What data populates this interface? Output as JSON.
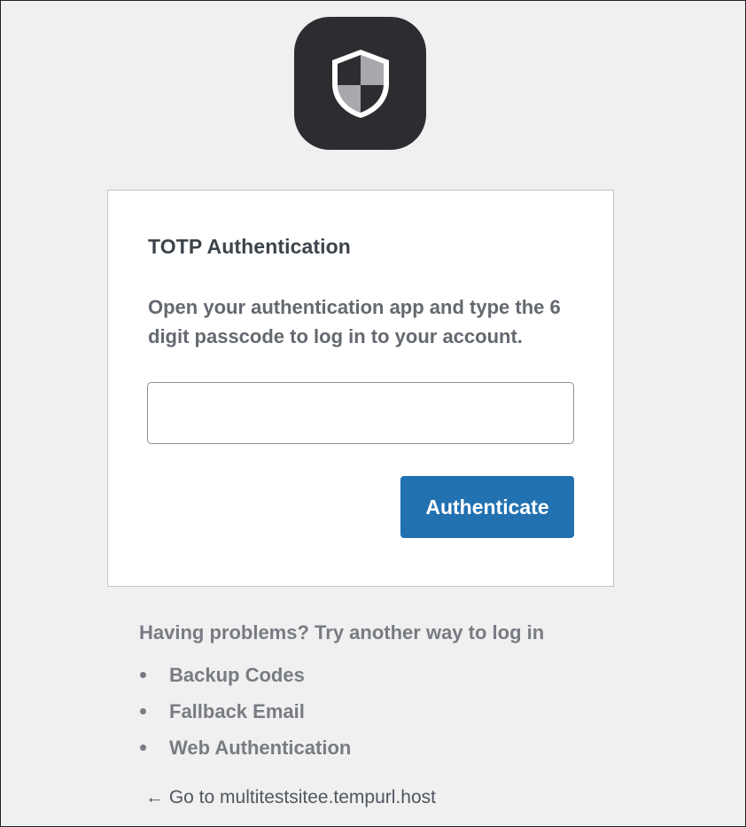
{
  "logo": {
    "icon": "shield-icon",
    "bg_color": "#2c2d30"
  },
  "card": {
    "title": "TOTP Authentication",
    "description": "Open your authentication app and type the 6 digit passcode to log in to your account.",
    "input": {
      "value": "",
      "placeholder": ""
    },
    "button_label": "Authenticate",
    "button_color": "#2271b1"
  },
  "alternatives": {
    "heading": "Having problems? Try another way to log in",
    "options": [
      {
        "label": "Backup Codes"
      },
      {
        "label": "Fallback Email"
      },
      {
        "label": "Web Authentication"
      }
    ]
  },
  "footer": {
    "back_link": "← Go to multitestsitee.tempurl.host"
  }
}
